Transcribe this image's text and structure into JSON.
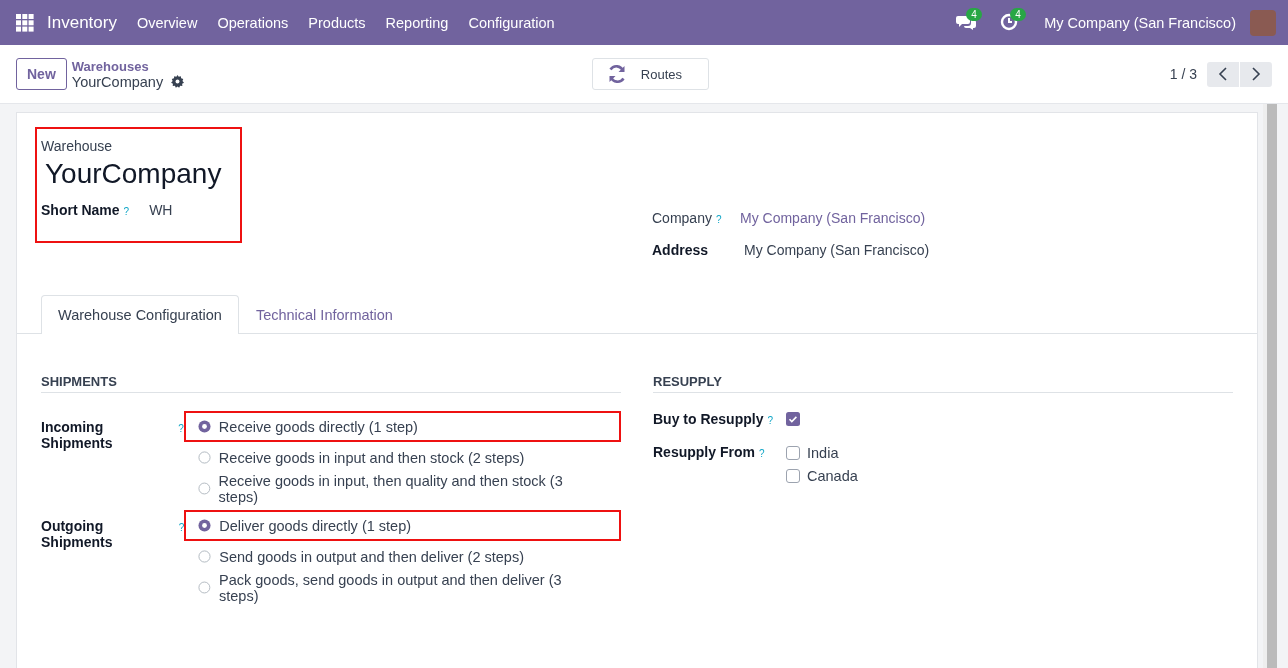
{
  "navbar": {
    "app": "Inventory",
    "menus": [
      "Overview",
      "Operations",
      "Products",
      "Reporting",
      "Configuration"
    ],
    "messages_count": "4",
    "activities_count": "4",
    "company": "My Company (San Francisco)"
  },
  "control_panel": {
    "new_button": "New",
    "breadcrumb": "Warehouses",
    "record": "YourCompany",
    "routes_button": "Routes",
    "pager": "1 / 3"
  },
  "form": {
    "title_block": {
      "highlighted": true,
      "label": "Warehouse",
      "name": "YourCompany",
      "short_name_label": "Short Name",
      "short_name_help": "?",
      "short_name": "WH"
    },
    "right_fields": [
      {
        "label": "Company",
        "help": "?",
        "value": "My Company (San Francisco)",
        "kind": "link"
      },
      {
        "label": "Address",
        "value": "My Company (San Francisco)",
        "kind": "text"
      }
    ],
    "tabs": [
      {
        "label": "Warehouse Configuration",
        "selected": true
      },
      {
        "label": "Technical Information",
        "selected": false
      }
    ],
    "shipments": {
      "title": "SHIPMENTS",
      "groups": [
        {
          "label": "Incoming Shipments",
          "help": "?",
          "options": [
            {
              "label": "Receive goods directly (1 step)",
              "selected": true,
              "highlighted": true
            },
            {
              "label": "Receive goods in input and then stock (2 steps)",
              "selected": false,
              "highlighted": false
            },
            {
              "label": "Receive goods in input, then quality and then stock (3 steps)",
              "selected": false,
              "highlighted": false
            }
          ]
        },
        {
          "label": "Outgoing Shipments",
          "help": "?",
          "options": [
            {
              "label": "Deliver goods directly (1 step)",
              "selected": true,
              "highlighted": true
            },
            {
              "label": "Send goods in output and then deliver (2 steps)",
              "selected": false,
              "highlighted": false
            },
            {
              "label": "Pack goods, send goods in output and then deliver (3 steps)",
              "selected": false,
              "highlighted": false
            }
          ]
        }
      ]
    },
    "resupply": {
      "title": "RESUPPLY",
      "buy": {
        "label": "Buy to Resupply",
        "help": "?",
        "checked": true
      },
      "from": {
        "label": "Resupply From",
        "help": "?",
        "options": [
          {
            "label": "India",
            "checked": false
          },
          {
            "label": "Canada",
            "checked": false
          }
        ]
      }
    }
  }
}
